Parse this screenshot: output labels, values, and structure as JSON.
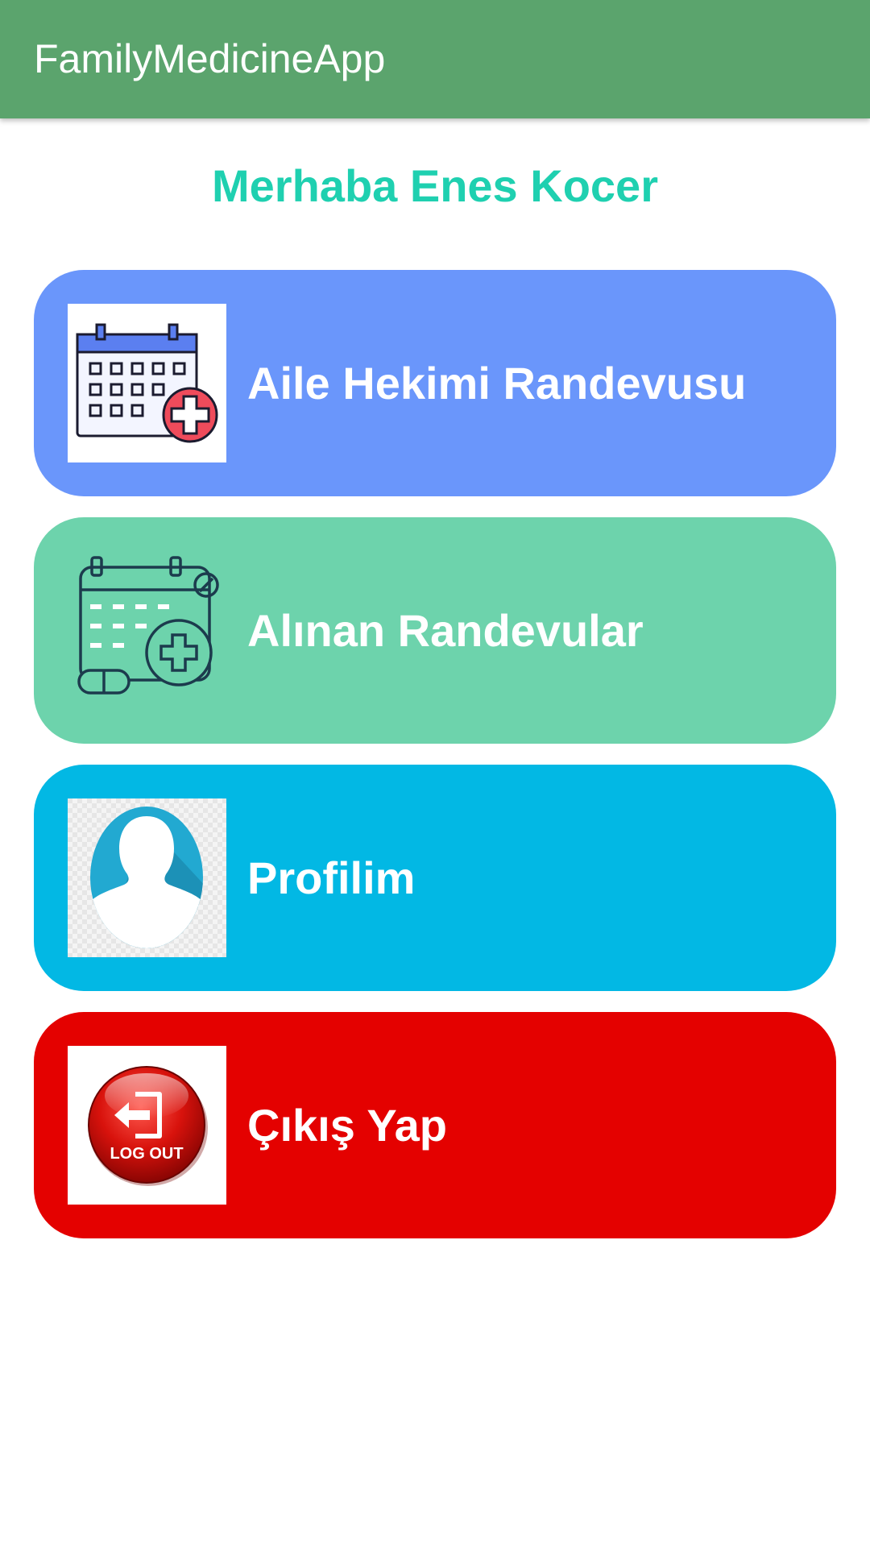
{
  "app_bar": {
    "title": "FamilyMedicineApp",
    "color": "#5ba46d"
  },
  "greeting": {
    "text": "Merhaba Enes Kocer",
    "color": "#1fd0b0"
  },
  "menu": [
    {
      "label": "Aile Hekimi Randevusu",
      "icon": "calendar-add-icon",
      "color": "#6a96fb"
    },
    {
      "label": "Alınan Randevular",
      "icon": "calendar-appointments-icon",
      "color": "#6dd3ac"
    },
    {
      "label": "Profilim",
      "icon": "user-profile-icon",
      "color": "#02b8e4"
    },
    {
      "label": "Çıkış Yap",
      "icon": "logout-icon",
      "icon_text": "LOG OUT",
      "color": "#e40100"
    }
  ]
}
